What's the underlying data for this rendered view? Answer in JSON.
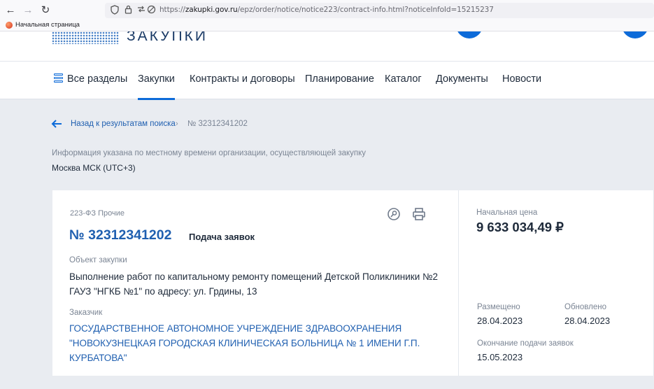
{
  "browser": {
    "url_prefix": "https://",
    "url_host": "zakupki.gov.ru",
    "url_path": "/epz/order/notice/notice223/contract-info.html?noticeInfoId=15215237",
    "bookmark_label": "Начальная страница"
  },
  "header": {
    "logo_text": "ЗАКУПКИ"
  },
  "nav": {
    "all_sections": "Все разделы",
    "items": [
      "Закупки",
      "Контракты и договоры",
      "Планирование",
      "Каталог",
      "Документы",
      "Новости"
    ],
    "active": "Закупки"
  },
  "breadcrumb": {
    "back_label": "Назад к результатам поиска",
    "separator": "›",
    "current": "№ 32312341202"
  },
  "timezone": {
    "note": "Информация указана по местному времени организации, осуществляющей закупку",
    "value": "Москва МСК (UTC+3)"
  },
  "notice": {
    "law_tag": "223-ФЗ Прочие",
    "number": "№ 32312341202",
    "stage": "Подача заявок",
    "object_label": "Объект закупки",
    "object_text": "Выполнение работ по капитальному ремонту помещений Детской Поликлиники №2 ГАУЗ \"НГКБ №1\" по адресу: ул. Грдины, 13",
    "customer_label": "Заказчик",
    "customer_text": "ГОСУДАРСТВЕННОЕ АВТОНОМНОЕ УЧРЕЖДЕНИЕ ЗДРАВООХРАНЕНИЯ \"НОВОКУЗНЕЦКАЯ ГОРОДСКАЯ КЛИНИЧЕСКАЯ БОЛЬНИЦА № 1 ИМЕНИ Г.П. КУРБАТОВА\"",
    "price_label": "Начальная цена",
    "price_value": "9 633 034,49 ₽",
    "posted_label": "Размещено",
    "posted_value": "28.04.2023",
    "updated_label": "Обновлено",
    "updated_value": "28.04.2023",
    "deadline_label": "Окончание подачи заявок",
    "deadline_value": "15.05.2023"
  },
  "colors": {
    "accent": "#0d6bd9",
    "link": "#1f5fb0",
    "text": "#1e2a3a",
    "muted": "#7b8594",
    "background": "#e9ecf1"
  },
  "icons": [
    "back-icon",
    "forward-icon",
    "reload-icon",
    "shield-icon",
    "lock-icon",
    "permissions-icon",
    "tracking-icon",
    "sections-icon",
    "back-arrow-icon",
    "watch-icon",
    "print-icon"
  ]
}
